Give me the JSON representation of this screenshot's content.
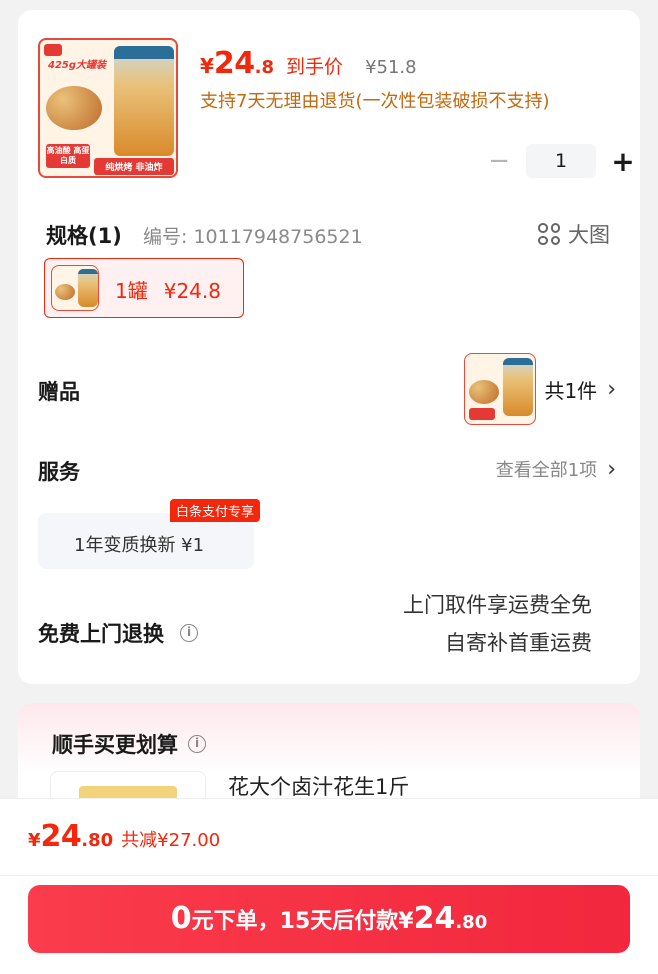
{
  "product": {
    "price_symbol": "¥",
    "price_int": "24",
    "price_dec": ".8",
    "arrive_label": "到手价",
    "original_price": "¥51.8",
    "return_note": "支持7天无理由退货(一次性包装破损不支持)",
    "quantity": "1",
    "image": {
      "shop_label": "官方旗舰店",
      "headline": "425g大罐装",
      "tag_left": "高油酸 高蛋白质",
      "tag_right": "纯烘烤 非油炸"
    }
  },
  "spec": {
    "title": "规格(1)",
    "code": "编号: 10117948756521",
    "big_image_label": "大图",
    "option_label": "1罐",
    "option_price": "¥24.8"
  },
  "gift": {
    "label": "赠品",
    "count": "共1件"
  },
  "service": {
    "label": "服务",
    "view_all": "查看全部1项",
    "option": "1年变质换新 ¥1",
    "badge": "白条支付专享"
  },
  "free_return": {
    "label": "免费上门退换",
    "line1": "上门取件享运费全免",
    "line2": "自寄补首重运费"
  },
  "addon": {
    "title": "顺手买更划算",
    "item_name": "花大个卤汁花生1斤"
  },
  "footer": {
    "total_symbol": "¥",
    "total_int": "24",
    "total_dec": ".80",
    "saving": "共减¥27.00",
    "cta_prefix_big": "0",
    "cta_text": "元下单，15天后付款",
    "cta_symbol": "¥",
    "cta_int": "24",
    "cta_dec": ".80"
  },
  "colors": {
    "accent_red": "#f2270c",
    "note_orange": "#c26a10"
  }
}
